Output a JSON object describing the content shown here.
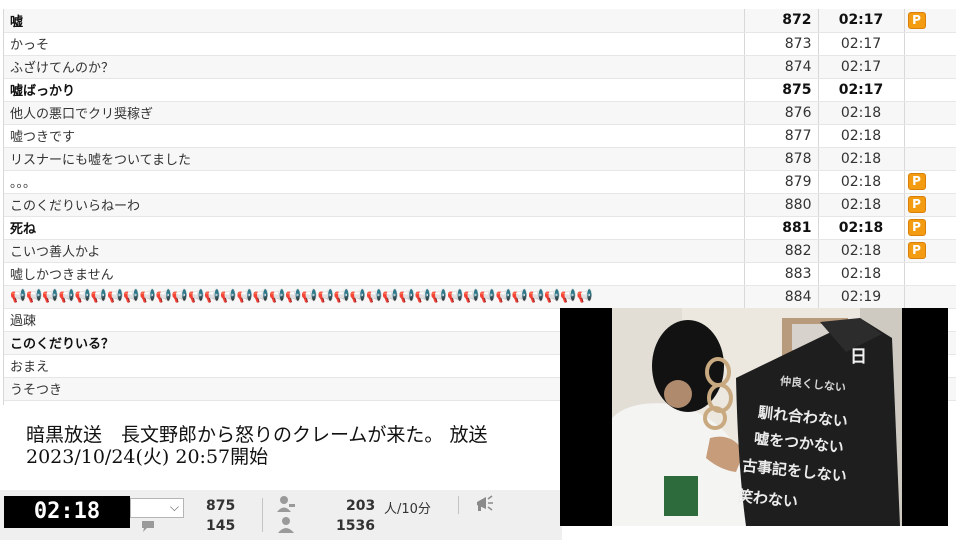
{
  "comments": [
    {
      "text": "嘘",
      "no": "872",
      "time": "02:17",
      "bold": true,
      "premium": true
    },
    {
      "text": "かっそ",
      "no": "873",
      "time": "02:17",
      "bold": false,
      "premium": false
    },
    {
      "text": "ふざけてんのか？",
      "no": "874",
      "time": "02:17",
      "bold": false,
      "premium": false
    },
    {
      "text": "嘘ばっかり",
      "no": "875",
      "time": "02:17",
      "bold": true,
      "premium": false
    },
    {
      "text": "他人の悪口でクリ奨稼ぎ",
      "no": "876",
      "time": "02:18",
      "bold": false,
      "premium": false
    },
    {
      "text": "嘘つきです",
      "no": "877",
      "time": "02:18",
      "bold": false,
      "premium": false
    },
    {
      "text": "リスナーにも嘘をついてました",
      "no": "878",
      "time": "02:18",
      "bold": false,
      "premium": false
    },
    {
      "text": "。。。",
      "no": "879",
      "time": "02:18",
      "bold": false,
      "premium": true
    },
    {
      "text": "このくだりいらねーわ",
      "no": "880",
      "time": "02:18",
      "bold": false,
      "premium": true
    },
    {
      "text": "死ね",
      "no": "881",
      "time": "02:18",
      "bold": true,
      "premium": true
    },
    {
      "text": "こいつ善人かよ",
      "no": "882",
      "time": "02:18",
      "bold": false,
      "premium": true
    },
    {
      "text": "嘘しかつきません",
      "no": "883",
      "time": "02:18",
      "bold": false,
      "premium": false
    },
    {
      "text": "📢📢📢📢📢📢📢📢📢📢📢📢📢📢📢📢📢📢📢📢📢📢📢📢📢📢📢📢📢📢📢📢📢📢📢📢",
      "no": "884",
      "time": "02:19",
      "bold": false,
      "premium": false
    },
    {
      "text": "過疎",
      "no": "",
      "time": "",
      "bold": false,
      "premium": false
    },
    {
      "text": "このくだりいる？",
      "no": "",
      "time": "",
      "bold": true,
      "premium": false
    },
    {
      "text": "おまえ",
      "no": "",
      "time": "",
      "bold": false,
      "premium": false
    },
    {
      "text": "うそつき",
      "no": "",
      "time": "",
      "bold": false,
      "premium": false
    }
  ],
  "premium_badge": "P",
  "broadcast": {
    "title": "暗黒放送　長文野郎から怒りのクレームが来た。 放送",
    "date": "2023/10/24(火) 20:57開始"
  },
  "status": {
    "elapsed": "02:18",
    "comments_count": "875",
    "sub_count": "145",
    "active_count": "203",
    "active_unit": "人/10分",
    "visitors": "1536"
  },
  "video": {
    "overlay_lines": [
      "日",
      "仲良くしない",
      "馴れ合わない",
      "嘘をつかない",
      "古事記をしない",
      "笑わない"
    ]
  },
  "colors": {
    "premium": "#f39c12",
    "time_bg": "#000000"
  }
}
